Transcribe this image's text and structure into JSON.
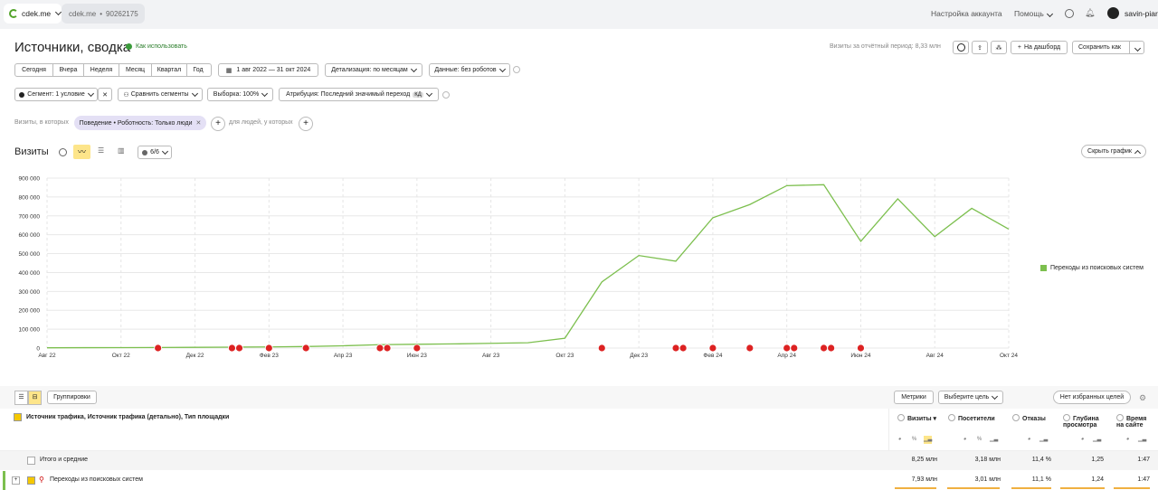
{
  "topbar": {
    "tab_site": "cdek.me",
    "tab_counter_site": "cdek.me",
    "tab_counter_sep": "•",
    "tab_counter_id": "90262175",
    "account_settings": "Настройка аккаунта",
    "help": "Помощь",
    "user": "savin-piar"
  },
  "header": {
    "title": "Источники, сводка",
    "howto": "Как использовать",
    "visits_period_label": "Визиты за отчётный период: 8,33 млн",
    "dashboard": "На дашборд",
    "save_as": "Сохранить как"
  },
  "periods": [
    "Сегодня",
    "Вчера",
    "Неделя",
    "Месяц",
    "Квартал",
    "Год"
  ],
  "date_range": "1 авг 2022 — 31 окт 2024",
  "detail": "Детализация: по месяцам",
  "data_filter": "Данные: без роботов",
  "segment": "Сегмент: 1 условие",
  "compare": "Сравнить сегменты",
  "sample": "Выборка: 100%",
  "attribution": "Атрибуция: Последний значимый переход",
  "attribution_badge": "КД",
  "filter": {
    "prefix": "Визиты, в которых",
    "chip": "Поведение • Роботность: Только люди",
    "suffix": "для людей, у которых"
  },
  "chart_panel": {
    "title": "Визиты",
    "series_count": "6/6",
    "hide": "Скрыть график"
  },
  "chart_data": {
    "type": "line",
    "x": [
      "Авг 22",
      "Сен 22",
      "Окт 22",
      "Ноя 22",
      "Дек 22",
      "Янв 23",
      "Фев 23",
      "Мар 23",
      "Апр 23",
      "Май 23",
      "Июн 23",
      "Июл 23",
      "Авг 23",
      "Сен 23",
      "Окт 23",
      "Ноя 23",
      "Дек 23",
      "Янв 24",
      "Фев 24",
      "Мар 24",
      "Апр 24",
      "Май 24",
      "Июн 24",
      "Июл 24",
      "Авг 24",
      "Сен 24",
      "Окт 24"
    ],
    "x_tick_labels": [
      "Авг 22",
      "Окт 22",
      "Дек 22",
      "Фев 23",
      "Апр 23",
      "Июн 23",
      "Авг 23",
      "Окт 23",
      "Дек 23",
      "Фев 24",
      "Апр 24",
      "Июн 24",
      "Авг 24",
      "Окт 24"
    ],
    "y_ticks": [
      "0",
      "100 000",
      "200 000",
      "300 000",
      "400 000",
      "500 000",
      "600 000",
      "700 000",
      "800 000",
      "900 000"
    ],
    "ylim": [
      0,
      900000
    ],
    "series": [
      {
        "name": "Переходы из поисковых систем",
        "color": "#7cbf4e",
        "values": [
          1500,
          2000,
          2500,
          3000,
          4000,
          5000,
          6000,
          8000,
          12000,
          18000,
          20000,
          22000,
          25000,
          28000,
          52000,
          350000,
          490000,
          460000,
          690000,
          760000,
          860000,
          865000,
          565000,
          790000,
          590000,
          740000,
          630000
        ]
      }
    ],
    "grid": true,
    "legend": "right"
  },
  "table": {
    "groupings": "Группировки",
    "metrics": "Метрики",
    "goal": "Выберите цель",
    "no_goals": "Нет избранных целей",
    "dim_header": "Источник трафика, Источник трафика (детально), Тип площадки",
    "columns": [
      "Визиты",
      "Посетители",
      "Отказы",
      "Глубина просмотра",
      "Время на сайте"
    ],
    "col_depth_1": "Глубина",
    "col_depth_2": "просмотра",
    "col_time_1": "Время",
    "col_time_2": "на сайте",
    "total_label": "Итого и средние",
    "total": [
      "8,25 млн",
      "3,18 млн",
      "11,4 %",
      "1,25",
      "1:47"
    ],
    "row1_label": "Переходы из поисковых систем",
    "row1": [
      "7,93 млн",
      "3,01 млн",
      "11,1 %",
      "1,24",
      "1:47"
    ]
  }
}
